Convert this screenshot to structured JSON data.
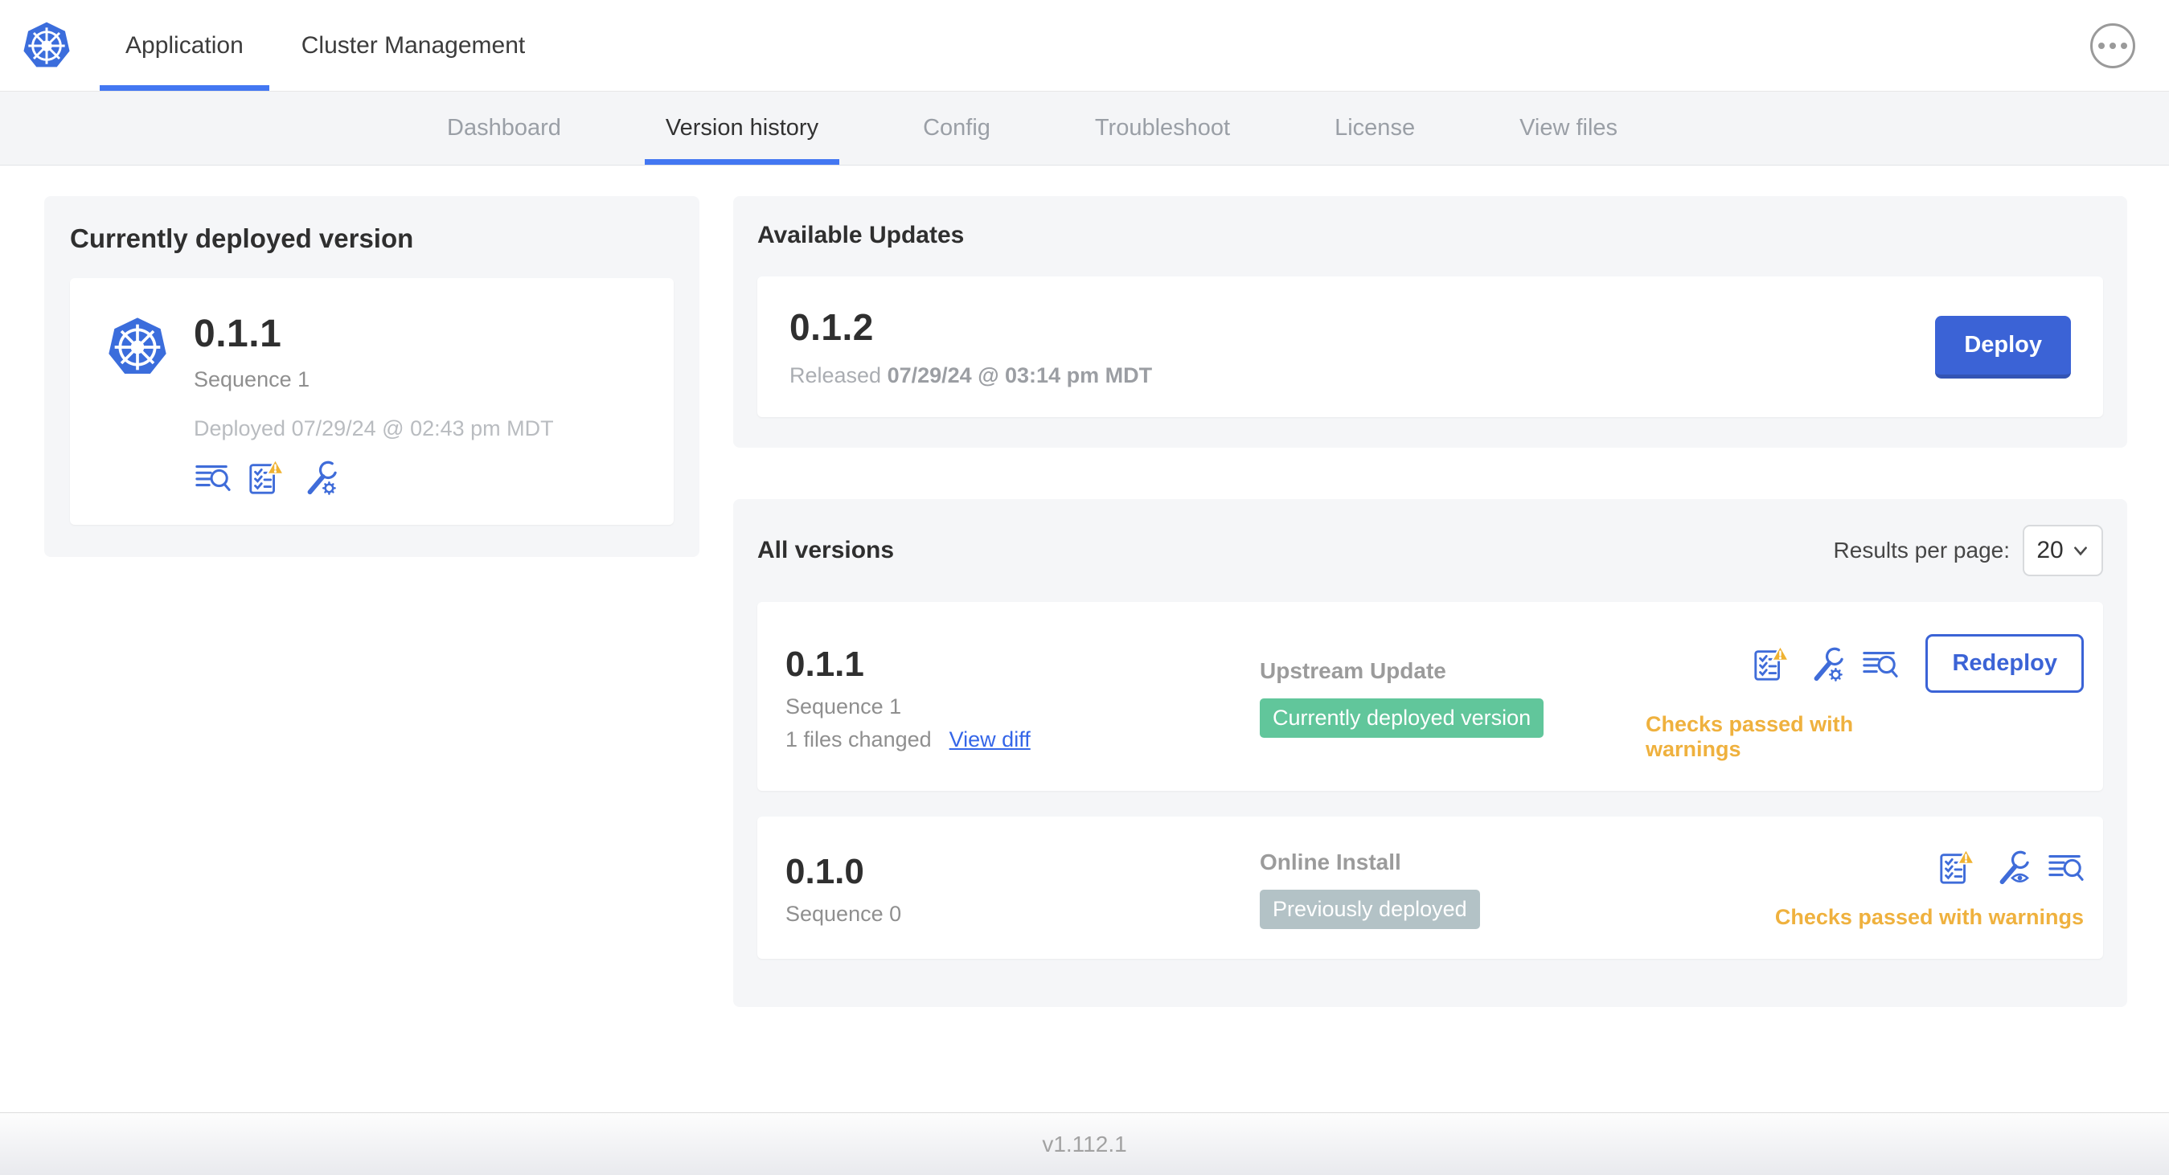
{
  "colors": {
    "accent_blue": "#3b63d6",
    "underline_blue": "#4377f2",
    "link_blue": "#3566e8",
    "icon_blue": "#3f6cd9",
    "warning_amber": "#efb13e",
    "badge_green": "#61c69b",
    "badge_gray": "#b3c2c6",
    "panel_gray": "#f5f6f8"
  },
  "top_nav": {
    "tabs": [
      {
        "label": "Application"
      },
      {
        "label": "Cluster Management"
      }
    ]
  },
  "sub_nav": {
    "tabs": [
      {
        "label": "Dashboard"
      },
      {
        "label": "Version history"
      },
      {
        "label": "Config"
      },
      {
        "label": "Troubleshoot"
      },
      {
        "label": "License"
      },
      {
        "label": "View files"
      }
    ]
  },
  "current_version_card": {
    "title": "Currently deployed version",
    "version": "0.1.1",
    "sequence": "Sequence 1",
    "deployed": "Deployed 07/29/24 @ 02:43 pm MDT",
    "icons": [
      "view-diff-logs-icon",
      "preflight-checks-warning-icon",
      "edit-config-icon"
    ]
  },
  "available_updates": {
    "title": "Available Updates",
    "version": "0.1.2",
    "released_prefix": "Released",
    "released_date": "07/29/24 @ 03:14 pm MDT",
    "deploy_label": "Deploy"
  },
  "all_versions": {
    "title": "All versions",
    "results_per_page_label": "Results per page:",
    "results_per_page_value": "20",
    "rows": [
      {
        "version": "0.1.1",
        "sequence": "Sequence 1",
        "files_changed": "1 files changed",
        "view_diff_label": "View diff",
        "source": "Upstream Update",
        "badge": {
          "label": "Currently deployed version",
          "color": "#61c69b"
        },
        "icons": [
          "preflight-checks-warning-icon",
          "edit-config-icon",
          "view-diff-logs-icon"
        ],
        "action_label": "Redeploy",
        "status": "Checks passed with warnings"
      },
      {
        "version": "0.1.0",
        "sequence": "Sequence 0",
        "source": "Online Install",
        "badge": {
          "label": "Previously deployed",
          "color": "#b3c2c6"
        },
        "icons": [
          "preflight-checks-warning-icon",
          "view-config-icon",
          "view-diff-logs-icon"
        ],
        "status": "Checks passed with warnings"
      }
    ]
  },
  "footer": {
    "version": "v1.112.1"
  }
}
